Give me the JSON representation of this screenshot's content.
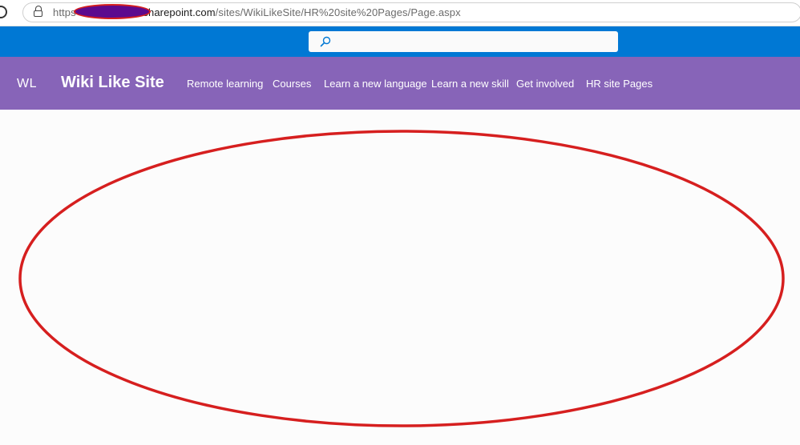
{
  "browser": {
    "url_scheme": "https",
    "url_host": "i.sharepoint.com",
    "url_path": "/sites/WikiLikeSite/HR%20site%20Pages/Page.aspx",
    "reload_icon": "reload-icon",
    "lock_icon": "lock-icon"
  },
  "suite_bar": {
    "color": "#0078d4",
    "search_icon": "search-icon",
    "search_placeholder": ""
  },
  "site": {
    "logo_text": "WL",
    "title": "Wiki Like Site",
    "header_color": "#8764b8",
    "nav": [
      "Remote learning",
      "Courses",
      "Learn a new language",
      "Learn a new skill",
      "Get involved",
      "HR site Pages"
    ]
  },
  "annotation": {
    "color": "#d61f1f"
  }
}
